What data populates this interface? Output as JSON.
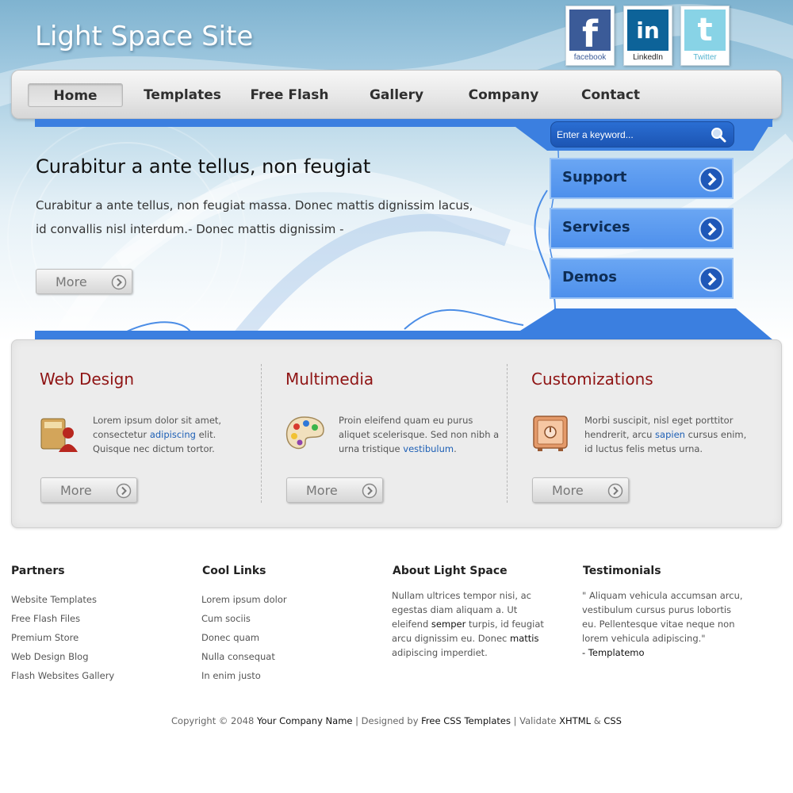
{
  "site": {
    "title": "Light Space Site"
  },
  "social": [
    {
      "name": "facebook",
      "icon": "facebook-icon",
      "caption": "facebook",
      "letters": "f"
    },
    {
      "name": "linkedin",
      "icon": "linkedin-icon",
      "caption": "LinkedIn",
      "letters": "in"
    },
    {
      "name": "twitter",
      "icon": "twitter-icon",
      "caption": "Twitter",
      "letters": "t"
    }
  ],
  "nav": {
    "items": [
      "Home",
      "Templates",
      "Free Flash",
      "Gallery",
      "Company",
      "Contact"
    ],
    "active": "Home"
  },
  "search": {
    "placeholder": "Enter a keyword...",
    "icon": "search-icon"
  },
  "hero": {
    "title": "Curabitur a ante tellus, non feugiat",
    "text": "Curabitur a ante tellus, non feugiat massa. Donec mattis dignissim lacus, id convallis nisl interdum.- Donec mattis dignissim -",
    "more_label": "More"
  },
  "side_buttons": [
    {
      "label": "Support",
      "icon": "arrow-right-icon"
    },
    {
      "label": "Services",
      "icon": "arrow-right-icon"
    },
    {
      "label": "Demos",
      "icon": "arrow-right-icon"
    }
  ],
  "features": [
    {
      "title": "Web Design",
      "icon": "user-folder-icon",
      "text_before": "Lorem ipsum dolor sit amet, consectetur ",
      "link": "adipiscing",
      "text_after": " elit. Quisque nec dictum tortor.",
      "more_label": "More"
    },
    {
      "title": "Multimedia",
      "icon": "palette-icon",
      "text_before": "Proin eleifend quam eu purus aliquet scelerisque. Sed non nibh a urna tristique ",
      "link": "vestibulum",
      "text_after": ".",
      "more_label": "More"
    },
    {
      "title": "Customizations",
      "icon": "safe-icon",
      "text_before": "Morbi suscipit, nisl eget porttitor hendrerit, arcu ",
      "link": "sapien",
      "text_after": " cursus enim, id luctus felis metus urna.",
      "more_label": "More"
    }
  ],
  "footer": {
    "partners": {
      "title": "Partners",
      "links": [
        "Website Templates",
        "Free Flash Files",
        "Premium Store",
        "Web Design Blog",
        "Flash Websites Gallery"
      ]
    },
    "cool_links": {
      "title": "Cool Links",
      "links": [
        "Lorem ipsum dolor",
        "Cum sociis",
        "Donec quam",
        "Nulla consequat",
        "In enim justo"
      ]
    },
    "about": {
      "title": "About Light Space",
      "t1": "Nullam ultrices tempor nisi, ac egestas diam aliquam a. Ut eleifend ",
      "k1": "semper",
      "t2": " turpis, id feugiat arcu dignissim eu. Donec ",
      "k2": "mattis",
      "t3": " adipiscing imperdiet."
    },
    "testimonials": {
      "title": "Testimonials",
      "quote": "\" Aliquam vehicula accumsan arcu, vestibulum cursus purus lobortis eu. Pellentesque vitae neque non lorem vehicula adipiscing.\"",
      "author": "- Templatemo"
    },
    "copyright": {
      "prefix": "Copyright © 2048 ",
      "company": "Your Company Name",
      "sep1": " | Designed by ",
      "designer": "Free CSS Templates",
      "sep2": " | Validate ",
      "xhtml": "XHTML",
      "amp": " & ",
      "css": "CSS"
    }
  },
  "colors": {
    "accent_blue": "#3b7fe0",
    "side_button_blue": "#5b9bee",
    "feature_title_red": "#8f1414",
    "link_blue": "#1d5fb5"
  }
}
